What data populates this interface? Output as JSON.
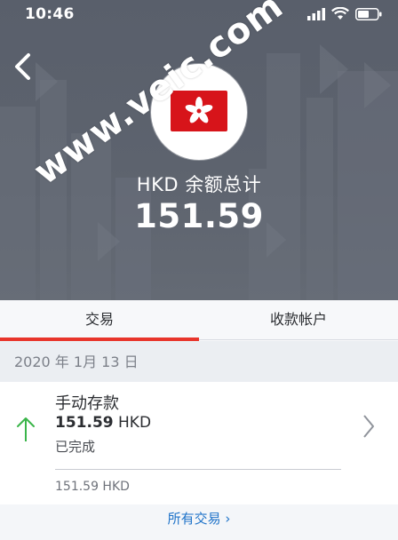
{
  "status_bar": {
    "time": "10:46"
  },
  "balance": {
    "label": "HKD 余额总计",
    "amount": "151.59"
  },
  "tabs": [
    {
      "label": "交易",
      "active": true
    },
    {
      "label": "收款帐户",
      "active": false
    }
  ],
  "transactions": {
    "date": "2020 年 1月 13 日",
    "items": [
      {
        "title": "手动存款",
        "amount": "151.59",
        "currency": "HKD",
        "status": "已完成",
        "secondary": "151.59 HKD"
      }
    ]
  },
  "footer": {
    "all_link": "所有交易 ›"
  },
  "watermark": "www.veic.com",
  "colors": {
    "accent_red": "#e8352b",
    "link_blue": "#1f73c9",
    "deposit_green": "#3ab54a",
    "hero_gray": "#5d636e"
  },
  "icons": [
    "back-chevron-icon",
    "signal-icon",
    "wifi-icon",
    "battery-icon",
    "hong-kong-flag-icon",
    "arrow-up-icon",
    "chevron-right-icon"
  ]
}
